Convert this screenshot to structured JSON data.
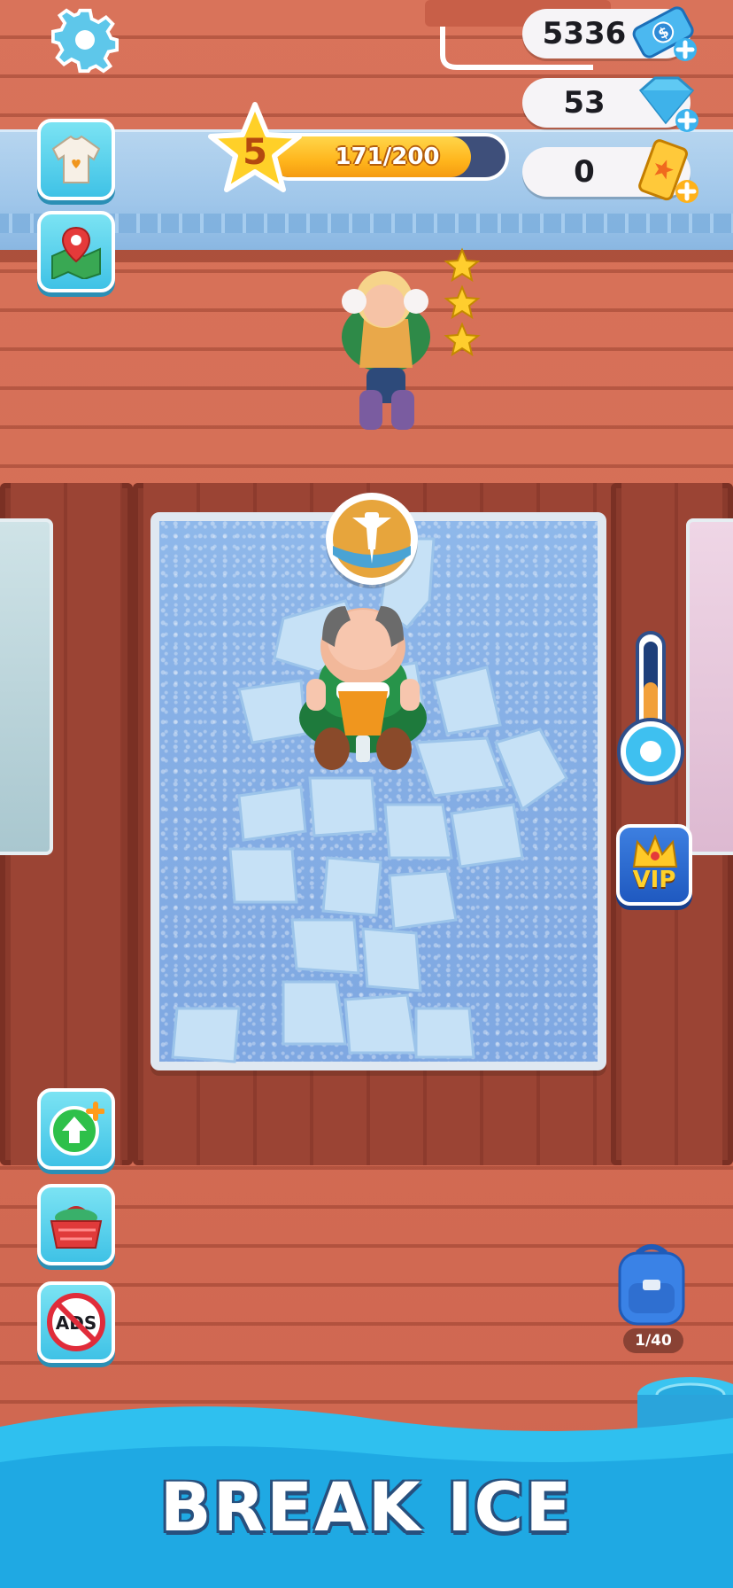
{
  "currency": {
    "cash": "5336",
    "gems": "53",
    "tickets": "0"
  },
  "level": {
    "number": "5",
    "xp_label": "171/200",
    "xp_fraction": 0.855
  },
  "vip": {
    "label": "VIP"
  },
  "no_ads": {
    "label": "ADS"
  },
  "backpack": {
    "count_label": "1/40"
  },
  "customer": {
    "star_rating": 3
  },
  "banner": {
    "title": "BREAK ICE"
  },
  "icons": {
    "settings": "gear-icon",
    "outfit": "tshirt-icon",
    "map": "map-pin-icon",
    "upgrade": "upgrade-arrow-icon",
    "shop": "basket-icon",
    "no_ads": "no-ads-icon",
    "backpack": "backpack-icon",
    "tool": "jackhammer-icon",
    "temperature": "thermometer-icon",
    "vip": "crown-icon"
  },
  "colors": {
    "accent_cyan": "#3fc2e6",
    "xp_fill": "#ffb51c",
    "vip_blue": "#1f59c0",
    "banner_text": "#ffffff"
  }
}
